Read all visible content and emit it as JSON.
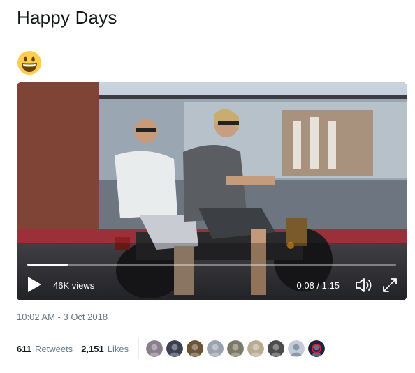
{
  "tweet": {
    "text": "Happy Days",
    "emoji_icon": "grinning-face-emoji"
  },
  "video": {
    "views": "46K views",
    "time": "0:08 / 1:15",
    "progress": 0.11,
    "play_icon": "play-icon",
    "volume_icon": "volume-icon",
    "fullscreen_icon": "fullscreen-icon"
  },
  "timestamp": "10:02 AM - 3 Oct 2018",
  "stats": {
    "retweets_count": "611",
    "retweets_label": "Retweets",
    "likes_count": "2,151",
    "likes_label": "Likes"
  },
  "likers": {
    "count": 9,
    "colors": [
      "#8a7f8e",
      "#3c3f52",
      "#6b5336",
      "#9aa2b0",
      "#7d7866",
      "#b8ab92",
      "#4c4c4c",
      "#c3ccd6",
      "#1a2340"
    ]
  }
}
